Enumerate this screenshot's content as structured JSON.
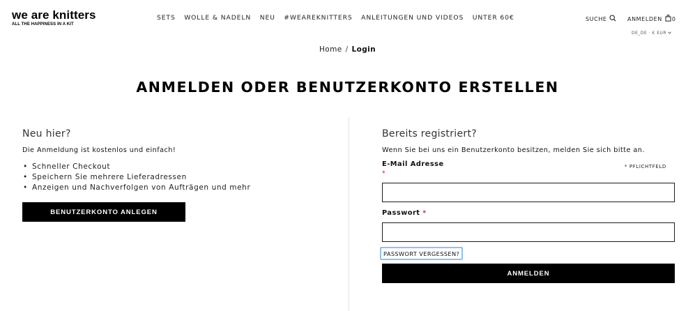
{
  "brand": {
    "name": "we are knitters",
    "tagline": "ALL THE HAPPINESS IN A KIT"
  },
  "nav": {
    "items": [
      {
        "label": "SETS"
      },
      {
        "label": "WOLLE & NADELN"
      },
      {
        "label": "NEU"
      },
      {
        "label": "#WEAREKNITTERS"
      },
      {
        "label": "ANLEITUNGEN UND VIDEOS"
      },
      {
        "label": "UNTER 60€"
      }
    ]
  },
  "header": {
    "search_label": "SUCHE",
    "login_label": "ANMELDEN",
    "cart_count": "0",
    "locale": "DE_DE · € EUR"
  },
  "breadcrumb": {
    "home": "Home",
    "separator": "/",
    "current": "Login"
  },
  "page": {
    "title": "ANMELDEN ODER BENUTZERKONTO ERSTELLEN"
  },
  "new_customer": {
    "heading": "Neu hier?",
    "intro": "Die Anmeldung ist kostenlos und einfach!",
    "benefits": [
      "Schneller Checkout",
      "Speichern Sie mehrere Lieferadressen",
      "Anzeigen und Nachverfolgen von Aufträgen und mehr"
    ],
    "create_button": "BENUTZERKONTO ANLEGEN"
  },
  "registered": {
    "heading": "Bereits registriert?",
    "intro": "Wenn Sie bei uns ein Benutzerkonto besitzen, melden Sie sich bitte an.",
    "email_label": "E-Mail Adresse",
    "email_value": "",
    "required_star": "*",
    "required_note": "* PFLICHTFELD",
    "password_label": "Passwort",
    "password_value": "",
    "forgot_link": "PASSWORT VERGESSEN?",
    "login_button": "ANMELDEN"
  },
  "colors": {
    "primary_button": "#000000",
    "required_star": "#c21818",
    "focus_ring": "#8fc1ee"
  }
}
